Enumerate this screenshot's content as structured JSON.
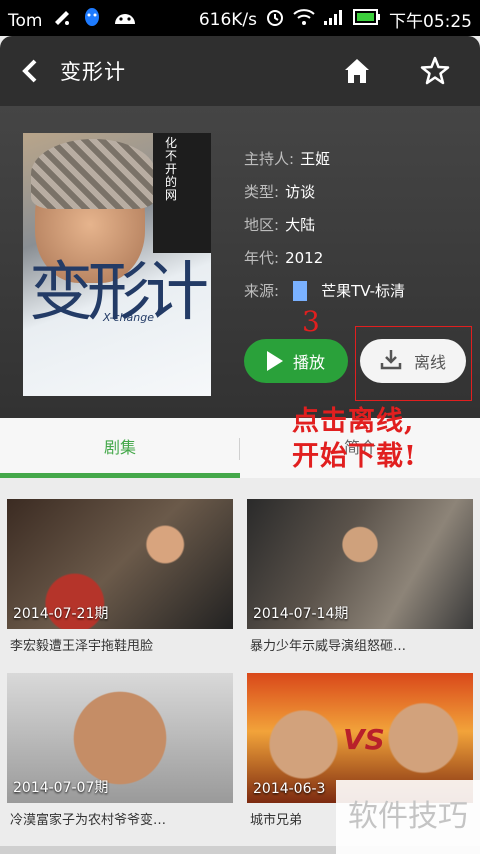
{
  "status_bar": {
    "carrier": "Tom",
    "net_speed": "616K/s",
    "time": "下午05:25"
  },
  "header": {
    "title": "变形计"
  },
  "detail": {
    "poster_title": "变形计",
    "poster_subtitle": "X-change",
    "poster_vertical_text": "化不开的网",
    "fields": [
      {
        "label": "主持人:",
        "value": "王姬"
      },
      {
        "label": "类型:",
        "value": "访谈"
      },
      {
        "label": "地区:",
        "value": "大陆"
      },
      {
        "label": "年代:",
        "value": "2012"
      },
      {
        "label": "来源:",
        "value": "芒果TV-标清"
      }
    ],
    "play_label": "播放",
    "offline_label": "离线"
  },
  "annotation": {
    "step_number": "3",
    "line1": "点击离线,",
    "line2": "开始下载!"
  },
  "tabs": [
    {
      "label": "剧集",
      "active": true
    },
    {
      "label": "简介",
      "active": false
    }
  ],
  "episodes": [
    {
      "date": "2014-07-21期",
      "title": "李宏毅遭王泽宇拖鞋甩脸"
    },
    {
      "date": "2014-07-14期",
      "title": "暴力少年示威导演组怒砸…"
    },
    {
      "date": "2014-07-07期",
      "title": "冷漠富家子为农村爷爷变…"
    },
    {
      "date": "2014-06-3",
      "title": "城市兄弟"
    }
  ],
  "watermark": "软件技巧",
  "colors": {
    "accent_green": "#2aa13a",
    "annotation_red": "#e11f1f",
    "header_bg": "#2f2f2f"
  }
}
